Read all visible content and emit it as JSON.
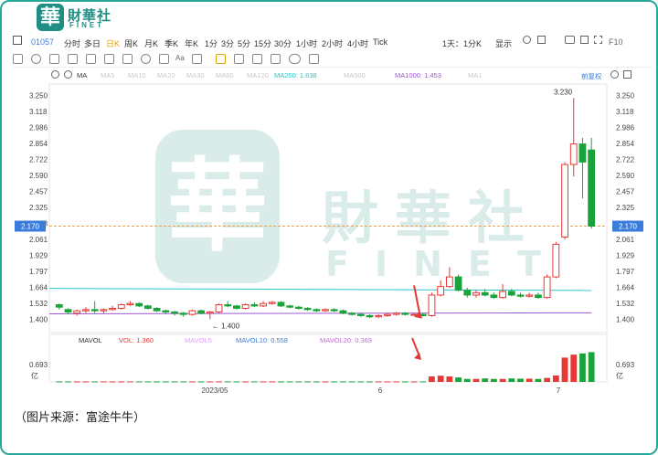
{
  "brand": {
    "seal_char": "華",
    "name": "財華社",
    "name_en": "FINET"
  },
  "toolbar": {
    "ticker": "01057",
    "periods": [
      "分时",
      "多日",
      "日K",
      "周K",
      "月K",
      "季K",
      "年K",
      "1分",
      "3分",
      "5分",
      "15分",
      "30分",
      "1小时",
      "2小时",
      "4小时",
      "Tick"
    ],
    "active_period": "日K",
    "interval": "1天：1分K",
    "display": "显示"
  },
  "indicators": {
    "ma_label": "MA",
    "items": [
      {
        "label": "MA5",
        "value": "",
        "color": "#c9c9c9"
      },
      {
        "label": "MA10",
        "value": "",
        "color": "#c9c9c9"
      },
      {
        "label": "MA20",
        "value": "",
        "color": "#c9c9c9"
      },
      {
        "label": "MA30",
        "value": "",
        "color": "#c9c9c9"
      },
      {
        "label": "MA60",
        "value": "",
        "color": "#c9c9c9"
      },
      {
        "label": "MA120",
        "value": "",
        "color": "#c9c9c9"
      },
      {
        "label": "MA250: 1.638",
        "value": "",
        "color": "#23c4c4"
      },
      {
        "label": "MA500",
        "value": "",
        "color": "#c9c9c9"
      },
      {
        "label": "MA1000: 1.453",
        "value": "",
        "color": "#9b59d0"
      },
      {
        "label": "MA1",
        "value": "",
        "color": "#c9c9c9"
      }
    ],
    "adjust": "前复权"
  },
  "chart_data": {
    "type": "candlestick",
    "y_ticks": [
      "3.250",
      "3.118",
      "2.986",
      "2.854",
      "2.722",
      "2.590",
      "2.457",
      "2.325",
      "2.193",
      "2.061",
      "1.929",
      "1.797",
      "1.664",
      "1.532",
      "1.400"
    ],
    "ylim": [
      1.32,
      3.3
    ],
    "current_price": "2.170",
    "high_label": "3.230",
    "low_label": "1.400",
    "x_labels": [
      "2023/05",
      "6",
      "7"
    ],
    "ma250_label": "MA250: 1.638",
    "ma1000_label": "MA1000: 1.453",
    "candles_note": "approximate daily OHLC, left to right",
    "candles": [
      [
        1.52,
        1.5,
        1.53,
        1.48
      ],
      [
        1.48,
        1.46,
        1.49,
        1.44
      ],
      [
        1.45,
        1.47,
        1.48,
        1.43
      ],
      [
        1.47,
        1.48,
        1.5,
        1.45
      ],
      [
        1.48,
        1.47,
        1.55,
        1.45
      ],
      [
        1.47,
        1.48,
        1.49,
        1.45
      ],
      [
        1.48,
        1.49,
        1.51,
        1.47
      ],
      [
        1.49,
        1.52,
        1.53,
        1.48
      ],
      [
        1.52,
        1.53,
        1.55,
        1.51
      ],
      [
        1.53,
        1.51,
        1.54,
        1.5
      ],
      [
        1.51,
        1.49,
        1.52,
        1.48
      ],
      [
        1.49,
        1.47,
        1.5,
        1.46
      ],
      [
        1.47,
        1.46,
        1.48,
        1.44
      ],
      [
        1.46,
        1.45,
        1.47,
        1.43
      ],
      [
        1.45,
        1.44,
        1.46,
        1.42
      ],
      [
        1.44,
        1.47,
        1.48,
        1.43
      ],
      [
        1.47,
        1.45,
        1.48,
        1.44
      ],
      [
        1.45,
        1.46,
        1.47,
        1.4
      ],
      [
        1.46,
        1.52,
        1.53,
        1.45
      ],
      [
        1.52,
        1.51,
        1.55,
        1.5
      ],
      [
        1.51,
        1.49,
        1.52,
        1.48
      ],
      [
        1.49,
        1.52,
        1.53,
        1.48
      ],
      [
        1.52,
        1.51,
        1.54,
        1.5
      ],
      [
        1.51,
        1.53,
        1.55,
        1.5
      ],
      [
        1.53,
        1.54,
        1.55,
        1.52
      ],
      [
        1.54,
        1.51,
        1.55,
        1.5
      ],
      [
        1.51,
        1.5,
        1.52,
        1.49
      ],
      [
        1.5,
        1.49,
        1.51,
        1.48
      ],
      [
        1.49,
        1.48,
        1.5,
        1.47
      ],
      [
        1.48,
        1.47,
        1.49,
        1.46
      ],
      [
        1.47,
        1.48,
        1.49,
        1.46
      ],
      [
        1.48,
        1.47,
        1.49,
        1.46
      ],
      [
        1.47,
        1.45,
        1.48,
        1.44
      ],
      [
        1.45,
        1.44,
        1.46,
        1.43
      ],
      [
        1.44,
        1.43,
        1.45,
        1.42
      ],
      [
        1.43,
        1.42,
        1.44,
        1.41
      ],
      [
        1.42,
        1.43,
        1.44,
        1.41
      ],
      [
        1.43,
        1.44,
        1.45,
        1.42
      ],
      [
        1.44,
        1.45,
        1.46,
        1.43
      ],
      [
        1.45,
        1.44,
        1.46,
        1.43
      ],
      [
        1.44,
        1.44,
        1.45,
        1.43
      ],
      [
        1.44,
        1.43,
        1.45,
        1.42
      ],
      [
        1.43,
        1.6,
        1.62,
        1.42
      ],
      [
        1.6,
        1.67,
        1.72,
        1.59
      ],
      [
        1.67,
        1.75,
        1.83,
        1.66
      ],
      [
        1.75,
        1.64,
        1.77,
        1.63
      ],
      [
        1.64,
        1.6,
        1.66,
        1.58
      ],
      [
        1.6,
        1.62,
        1.64,
        1.58
      ],
      [
        1.62,
        1.6,
        1.65,
        1.59
      ],
      [
        1.6,
        1.58,
        1.62,
        1.57
      ],
      [
        1.58,
        1.63,
        1.69,
        1.57
      ],
      [
        1.63,
        1.6,
        1.65,
        1.59
      ],
      [
        1.6,
        1.59,
        1.62,
        1.58
      ],
      [
        1.59,
        1.6,
        1.62,
        1.58
      ],
      [
        1.6,
        1.58,
        1.62,
        1.57
      ],
      [
        1.58,
        1.75,
        1.77,
        1.57
      ],
      [
        1.75,
        2.02,
        2.04,
        1.74
      ],
      [
        2.08,
        2.68,
        2.7,
        2.06
      ],
      [
        2.68,
        2.85,
        3.23,
        2.58
      ],
      [
        2.85,
        2.7,
        2.9,
        2.4
      ],
      [
        2.8,
        2.17,
        2.9,
        2.15
      ]
    ],
    "volume": {
      "labels": [
        "MAVOL",
        "VOL: 1.360",
        "MAVOL5",
        "MAVOL10: 0.558",
        "MAVOL20: 0.369"
      ],
      "y_ticks": [
        "0.693",
        "亿"
      ],
      "values_note": "approximate volume in 亿",
      "values": [
        0.02,
        0.02,
        0.02,
        0.02,
        0.02,
        0.02,
        0.02,
        0.02,
        0.02,
        0.02,
        0.02,
        0.02,
        0.02,
        0.02,
        0.02,
        0.02,
        0.02,
        0.02,
        0.02,
        0.02,
        0.02,
        0.02,
        0.02,
        0.02,
        0.02,
        0.02,
        0.02,
        0.02,
        0.02,
        0.02,
        0.02,
        0.02,
        0.02,
        0.02,
        0.02,
        0.02,
        0.02,
        0.02,
        0.02,
        0.02,
        0.02,
        0.02,
        0.22,
        0.25,
        0.22,
        0.18,
        0.12,
        0.12,
        0.14,
        0.12,
        0.12,
        0.14,
        0.13,
        0.13,
        0.12,
        0.16,
        0.26,
        0.98,
        1.1,
        1.15,
        1.2
      ],
      "ylim": [
        0,
        1.4
      ]
    }
  },
  "source_note": "（图片来源：富途牛牛）"
}
